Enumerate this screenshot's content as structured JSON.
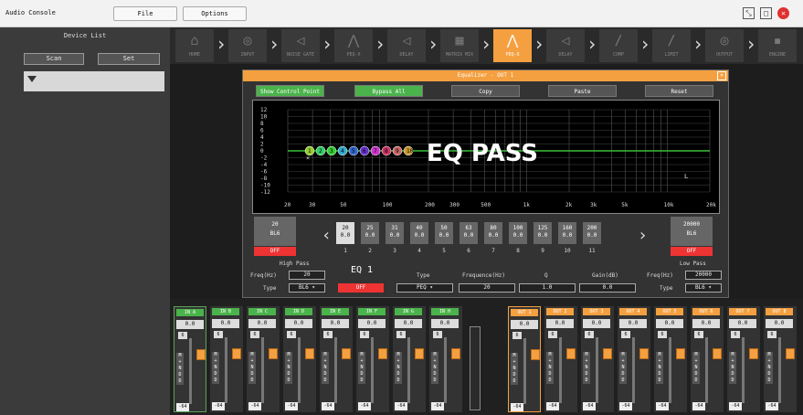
{
  "app": {
    "title": "Audio Console"
  },
  "menu": {
    "file": "File",
    "options": "Options"
  },
  "sidebar": {
    "title": "Device List",
    "scan": "Scan",
    "set": "Set"
  },
  "chain": [
    {
      "label": "HOME"
    },
    {
      "label": "INPUT"
    },
    {
      "label": "NOISE GATE"
    },
    {
      "label": "PEQ-X"
    },
    {
      "label": "DELAY"
    },
    {
      "label": "MATRIX MIX"
    },
    {
      "label": "PEQ-X"
    },
    {
      "label": "DELAY"
    },
    {
      "label": "COMP"
    },
    {
      "label": "LIMIT"
    },
    {
      "label": "OUTPUT"
    },
    {
      "label": "ENGINE"
    }
  ],
  "dialog": {
    "title": "Equalizer - OUT 1",
    "show_control_point": "Show Control Point",
    "bypass_all": "Bypass All",
    "copy": "Copy",
    "paste": "Paste",
    "reset": "Reset",
    "overlay": "EQ PASS",
    "y_ticks": [
      "12",
      "10",
      "8",
      "6",
      "4",
      "2",
      "0",
      "-2",
      "-4",
      "-6",
      "-8",
      "-10",
      "-12"
    ],
    "x_ticks": [
      "20",
      "30",
      "50",
      "100",
      "200",
      "300",
      "500",
      "1k",
      "2k",
      "3k",
      "5k",
      "10k",
      "20k"
    ],
    "hp_box": {
      "freq": "20",
      "type": "BL6"
    },
    "lp_box": {
      "freq": "20000",
      "type": "BL6"
    },
    "hp_off": "OFF",
    "lp_off": "OFF",
    "bands": [
      {
        "f": "20",
        "g": "0.0",
        "n": "1"
      },
      {
        "f": "25",
        "g": "0.0",
        "n": "2"
      },
      {
        "f": "31",
        "g": "0.0",
        "n": "3"
      },
      {
        "f": "40",
        "g": "0.0",
        "n": "4"
      },
      {
        "f": "50",
        "g": "0.0",
        "n": "5"
      },
      {
        "f": "63",
        "g": "0.0",
        "n": "6"
      },
      {
        "f": "80",
        "g": "0.0",
        "n": "7"
      },
      {
        "f": "100",
        "g": "0.0",
        "n": "8"
      },
      {
        "f": "125",
        "g": "0.0",
        "n": "9"
      },
      {
        "f": "160",
        "g": "0.0",
        "n": "10"
      },
      {
        "f": "200",
        "g": "0.0",
        "n": "11"
      }
    ],
    "high_pass": {
      "title": "High Pass",
      "freq_label": "Freq(Hz)",
      "freq": "20",
      "type_label": "Type",
      "type": "BL6"
    },
    "low_pass": {
      "title": "Low Pass",
      "freq_label": "Freq(Hz)",
      "freq": "20000",
      "type_label": "Type",
      "type": "BL6"
    },
    "eq": {
      "title": "EQ 1",
      "off": "OFF",
      "type_label": "Type",
      "type": "PEQ",
      "freq_label": "Frequence(Hz)",
      "freq": "20",
      "q_label": "Q",
      "q": "1.0",
      "gain_label": "Gain(dB)",
      "gain": "0.0"
    }
  },
  "strips": [
    {
      "name": "IN A",
      "val": "0.0",
      "kind": "in"
    },
    {
      "name": "IN B",
      "val": "0.0",
      "kind": "in"
    },
    {
      "name": "IN C",
      "val": "0.0",
      "kind": "in"
    },
    {
      "name": "IN D",
      "val": "0.0",
      "kind": "in"
    },
    {
      "name": "IN E",
      "val": "0.0",
      "kind": "in"
    },
    {
      "name": "IN F",
      "val": "0.0",
      "kind": "in"
    },
    {
      "name": "IN G",
      "val": "0.0",
      "kind": "in"
    },
    {
      "name": "IN H",
      "val": "0.0",
      "kind": "in"
    },
    {
      "name": "OUT 1",
      "val": "0.0",
      "kind": "out"
    },
    {
      "name": "OUT 2",
      "val": "0.0",
      "kind": "out"
    },
    {
      "name": "OUT 3",
      "val": "0.0",
      "kind": "out"
    },
    {
      "name": "OUT 4",
      "val": "0.0",
      "kind": "out"
    },
    {
      "name": "OUT 5",
      "val": "0.0",
      "kind": "out"
    },
    {
      "name": "OUT 6",
      "val": "0.0",
      "kind": "out"
    },
    {
      "name": "OUT 7",
      "val": "0.0",
      "kind": "out"
    },
    {
      "name": "OUT 8",
      "val": "0.0",
      "kind": "out"
    }
  ],
  "strip_common": {
    "top": "6",
    "bottom": "-64",
    "letters": [
      "M",
      "+",
      "N",
      "D",
      "D"
    ]
  },
  "colors": {
    "accent": "#f5a040",
    "green": "#4bb34b",
    "red": "#e33333"
  }
}
